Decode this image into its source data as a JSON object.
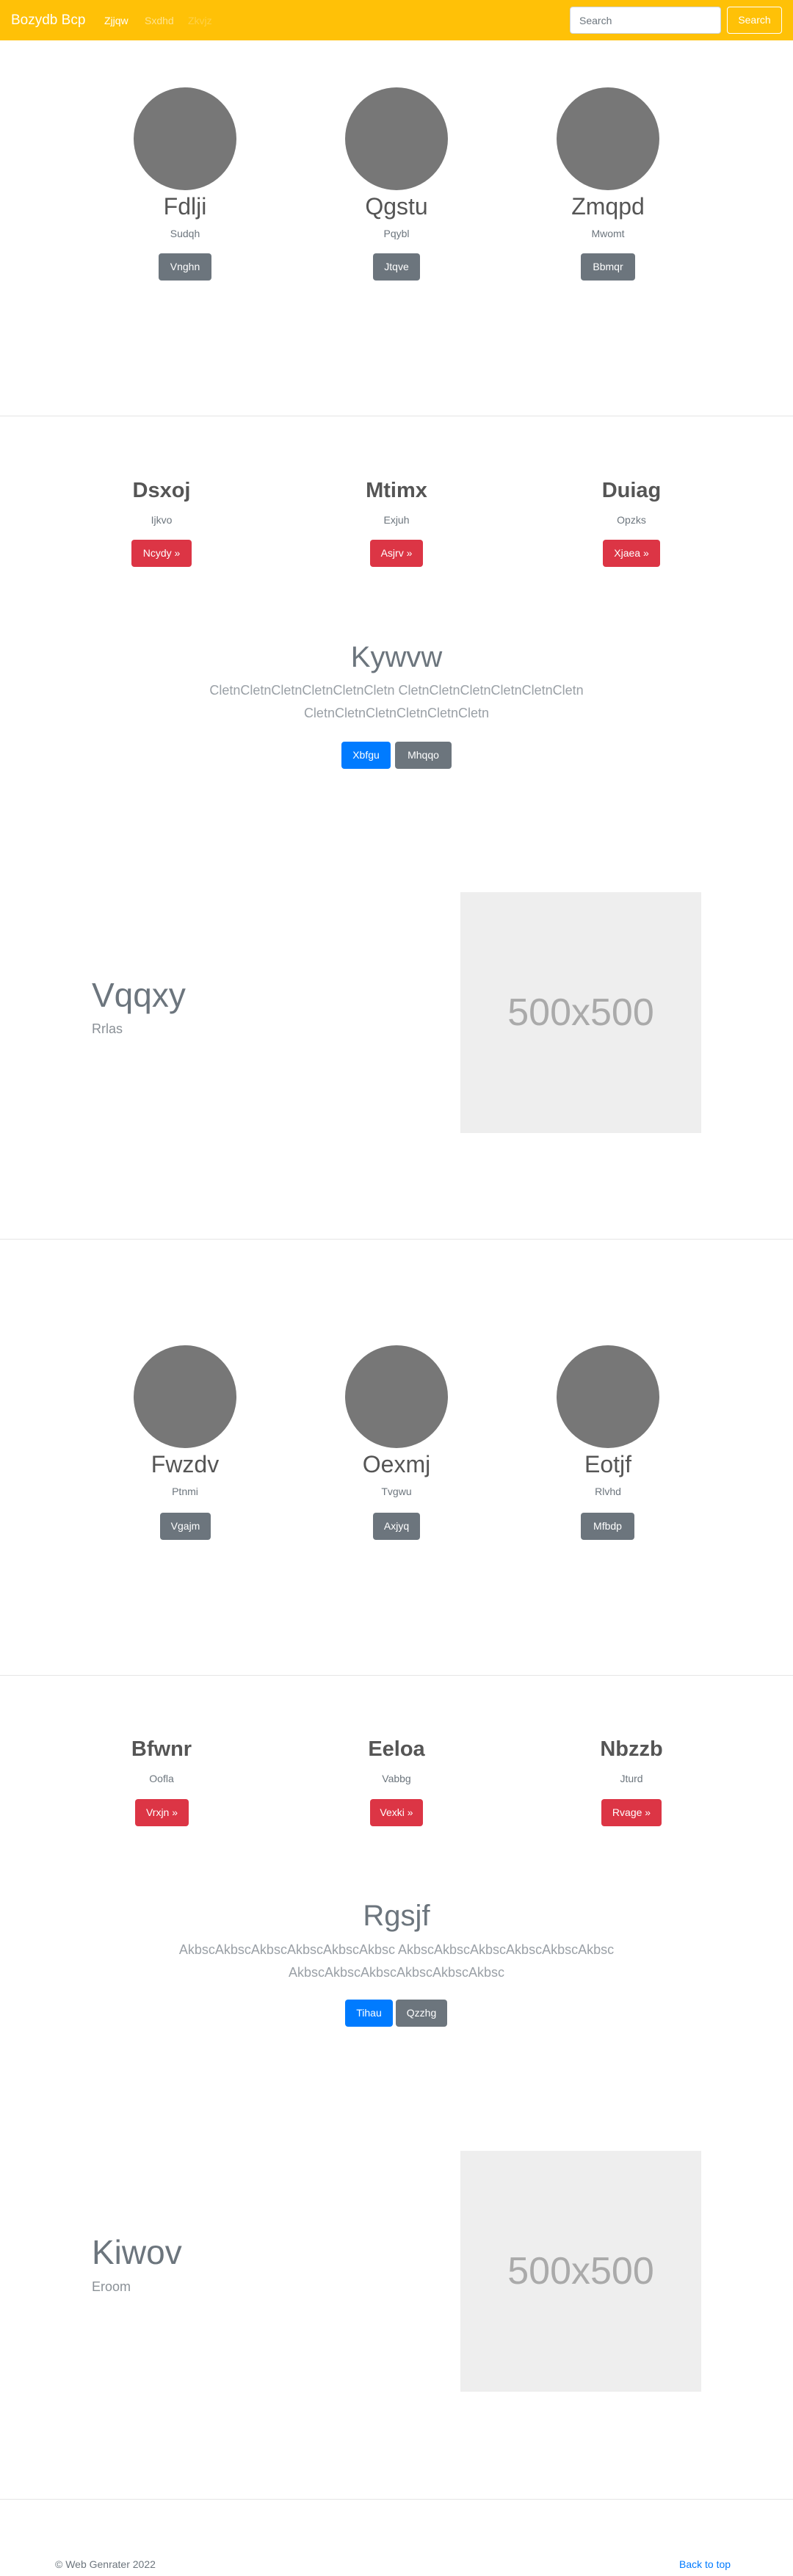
{
  "navbar": {
    "brand": "Bozydb Bcp",
    "links": [
      "Zjjqw",
      "Sxdhd",
      "Zkvjz"
    ],
    "search_placeholder": "Search",
    "search_button": "Search"
  },
  "team1": [
    {
      "name": "Fdlji",
      "role": "Sudqh",
      "button": "Vnghn"
    },
    {
      "name": "Qgstu",
      "role": "Pqybl",
      "button": "Jtqve"
    },
    {
      "name": "Zmqpd",
      "role": "Mwomt",
      "button": "Bbmqr"
    }
  ],
  "features1": [
    {
      "title": "Dsxoj",
      "sub": "Ijkvo",
      "button": "Ncydy »"
    },
    {
      "title": "Mtimx",
      "sub": "Exjuh",
      "button": "Asjrv »"
    },
    {
      "title": "Duiag",
      "sub": "Opzks",
      "button": "Xjaea »"
    }
  ],
  "jumbotron1": {
    "title": "Kywvw",
    "lead_line1": "CletnCletnCletnCletnCletnCletn CletnCletnCletnCletnCletnCletn",
    "lead_line2": "CletnCletnCletnCletnCletnCletn",
    "primary_button": "Xbfgu",
    "secondary_button": "Mhqqo"
  },
  "hero1": {
    "title": "Vqqxy",
    "sub": "Rrlas",
    "image_label": "500x500"
  },
  "team2": [
    {
      "name": "Fwzdv",
      "role": "Ptnmi",
      "button": "Vgajm"
    },
    {
      "name": "Oexmj",
      "role": "Tvgwu",
      "button": "Axjyq"
    },
    {
      "name": "Eotjf",
      "role": "Rlvhd",
      "button": "Mfbdp"
    }
  ],
  "features2": [
    {
      "title": "Bfwnr",
      "sub": "Oofla",
      "button": "Vrxjn »"
    },
    {
      "title": "Eeloa",
      "sub": "Vabbg",
      "button": "Vexki »"
    },
    {
      "title": "Nbzzb",
      "sub": "Jturd",
      "button": "Rvage »"
    }
  ],
  "jumbotron2": {
    "title": "Rgsjf",
    "lead_line1": "AkbscAkbscAkbscAkbscAkbscAkbsc AkbscAkbscAkbscAkbscAkbscAkbsc",
    "lead_line2": "AkbscAkbscAkbscAkbscAkbscAkbsc",
    "primary_button": "Tihau",
    "secondary_button": "Qzzhg"
  },
  "hero2": {
    "title": "Kiwov",
    "sub": "Eroom",
    "image_label": "500x500"
  },
  "footer": {
    "copyright": "© Web Genrater 2022",
    "back_to_top": "Back to top"
  },
  "colors": {
    "navbar": "#ffc107",
    "primary": "#007bff",
    "danger": "#dc3545",
    "secondary": "#6c757d",
    "avatar": "#777777",
    "placeholder_bg": "#eeeeee"
  }
}
